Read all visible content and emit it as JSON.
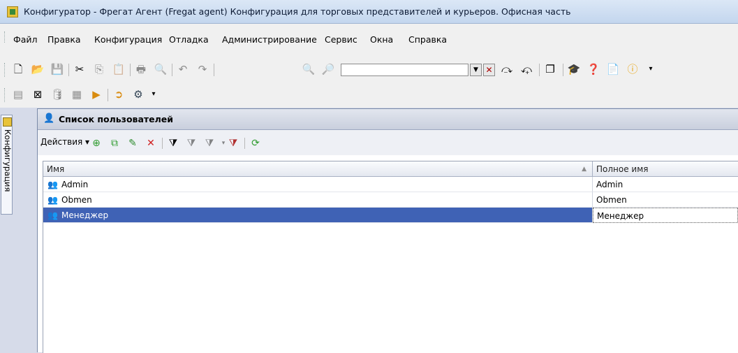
{
  "window": {
    "title": "Конфигуратор - Фрегат Агент (Fregat agent) Конфигурация для торговых представителей и курьеров. Офисная часть"
  },
  "menu": {
    "items": [
      "Файл",
      "Правка",
      "Конфигурация",
      "Отладка",
      "Администрирование",
      "Сервис",
      "Окна",
      "Справка"
    ]
  },
  "toolbar": {
    "search_value": ""
  },
  "sidebar": {
    "tab_label": "Конфигурация"
  },
  "panel": {
    "title": "Список пользователей",
    "actions_label": "Действия ▾",
    "columns": [
      "Имя",
      "Полное имя"
    ],
    "rows": [
      {
        "name": "Admin",
        "full_name": "Admin"
      },
      {
        "name": "Obmen",
        "full_name": "Obmen"
      },
      {
        "name": "Менеджер",
        "full_name": "Менеджер"
      }
    ],
    "selected_row": 2
  },
  "colors": {
    "selection": "#3f62b5",
    "title_bar": "#c3d6ee"
  }
}
